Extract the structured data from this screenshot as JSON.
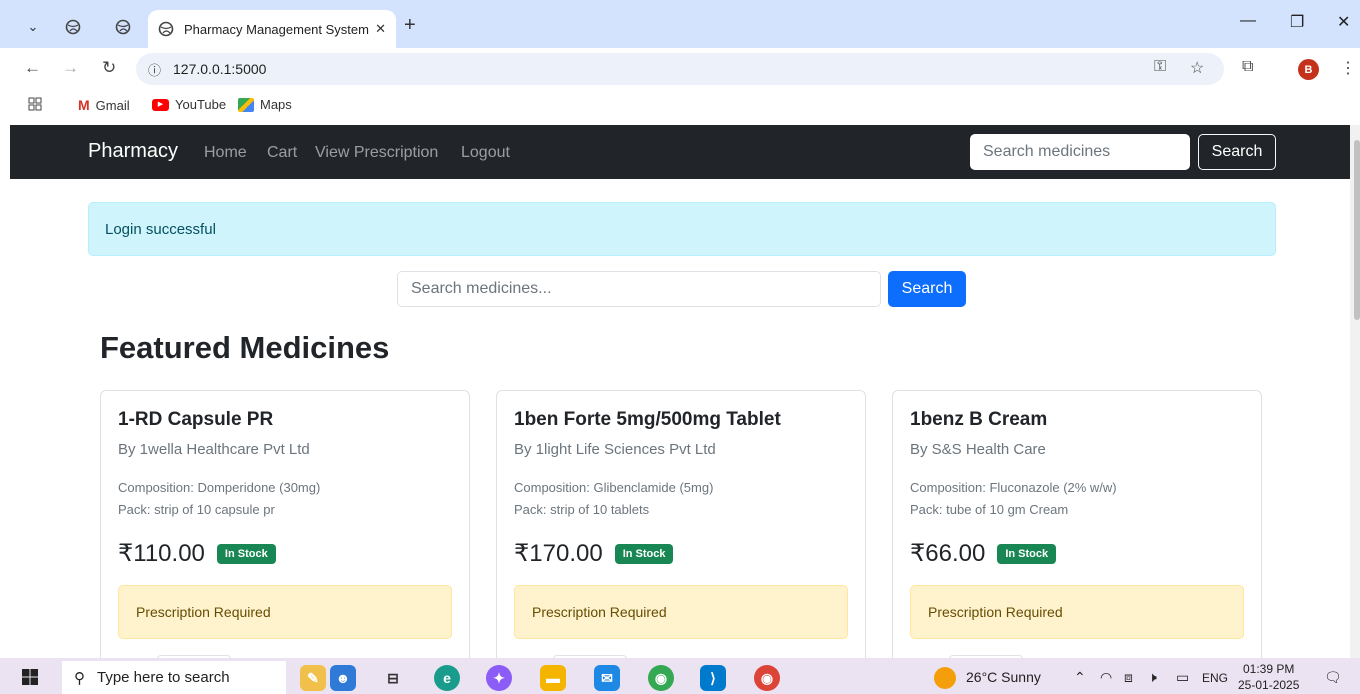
{
  "browser": {
    "tab_title": "Pharmacy Management System",
    "url": "127.0.0.1:5000",
    "avatar_letter": "B",
    "bookmarks": [
      {
        "label": "Gmail"
      },
      {
        "label": "YouTube"
      },
      {
        "label": "Maps"
      }
    ]
  },
  "navbar": {
    "brand": "Pharmacy",
    "links": [
      "Home",
      "Cart",
      "View Prescription",
      "Logout"
    ],
    "search_placeholder": "Search medicines",
    "search_button": "Search"
  },
  "alert": {
    "message": "Login successful"
  },
  "main_search": {
    "placeholder": "Search medicines...",
    "button": "Search"
  },
  "section_title": "Featured Medicines",
  "medicines": [
    {
      "name": "1-RD Capsule PR",
      "manufacturer": "By 1wella Healthcare Pvt Ltd",
      "composition": "Composition: Domperidone (30mg)",
      "pack": "Pack: strip of 10 capsule pr",
      "price": "₹110.00",
      "stock": "In Stock",
      "rx": "Prescription Required"
    },
    {
      "name": "1ben Forte 5mg/500mg Tablet",
      "manufacturer": "By 1light Life Sciences Pvt Ltd",
      "composition": "Composition: Glibenclamide (5mg)",
      "pack": "Pack: strip of 10 tablets",
      "price": "₹170.00",
      "stock": "In Stock",
      "rx": "Prescription Required"
    },
    {
      "name": "1benz B Cream",
      "manufacturer": "By S&S Health Care",
      "composition": "Composition: Fluconazole (2% w/w)",
      "pack": "Pack: tube of 10 gm Cream",
      "price": "₹66.00",
      "stock": "In Stock",
      "rx": "Prescription Required"
    }
  ],
  "taskbar": {
    "search_placeholder": "Type here to search",
    "weather": "26°C  Sunny",
    "language": "ENG",
    "time": "01:39 PM",
    "date": "25-01-2025"
  },
  "colors": {
    "navbar_bg": "#212529",
    "primary": "#0d6efd",
    "success": "#198754",
    "info_alert_bg": "#cff4fc",
    "warning_alert_bg": "#fff3cd"
  }
}
